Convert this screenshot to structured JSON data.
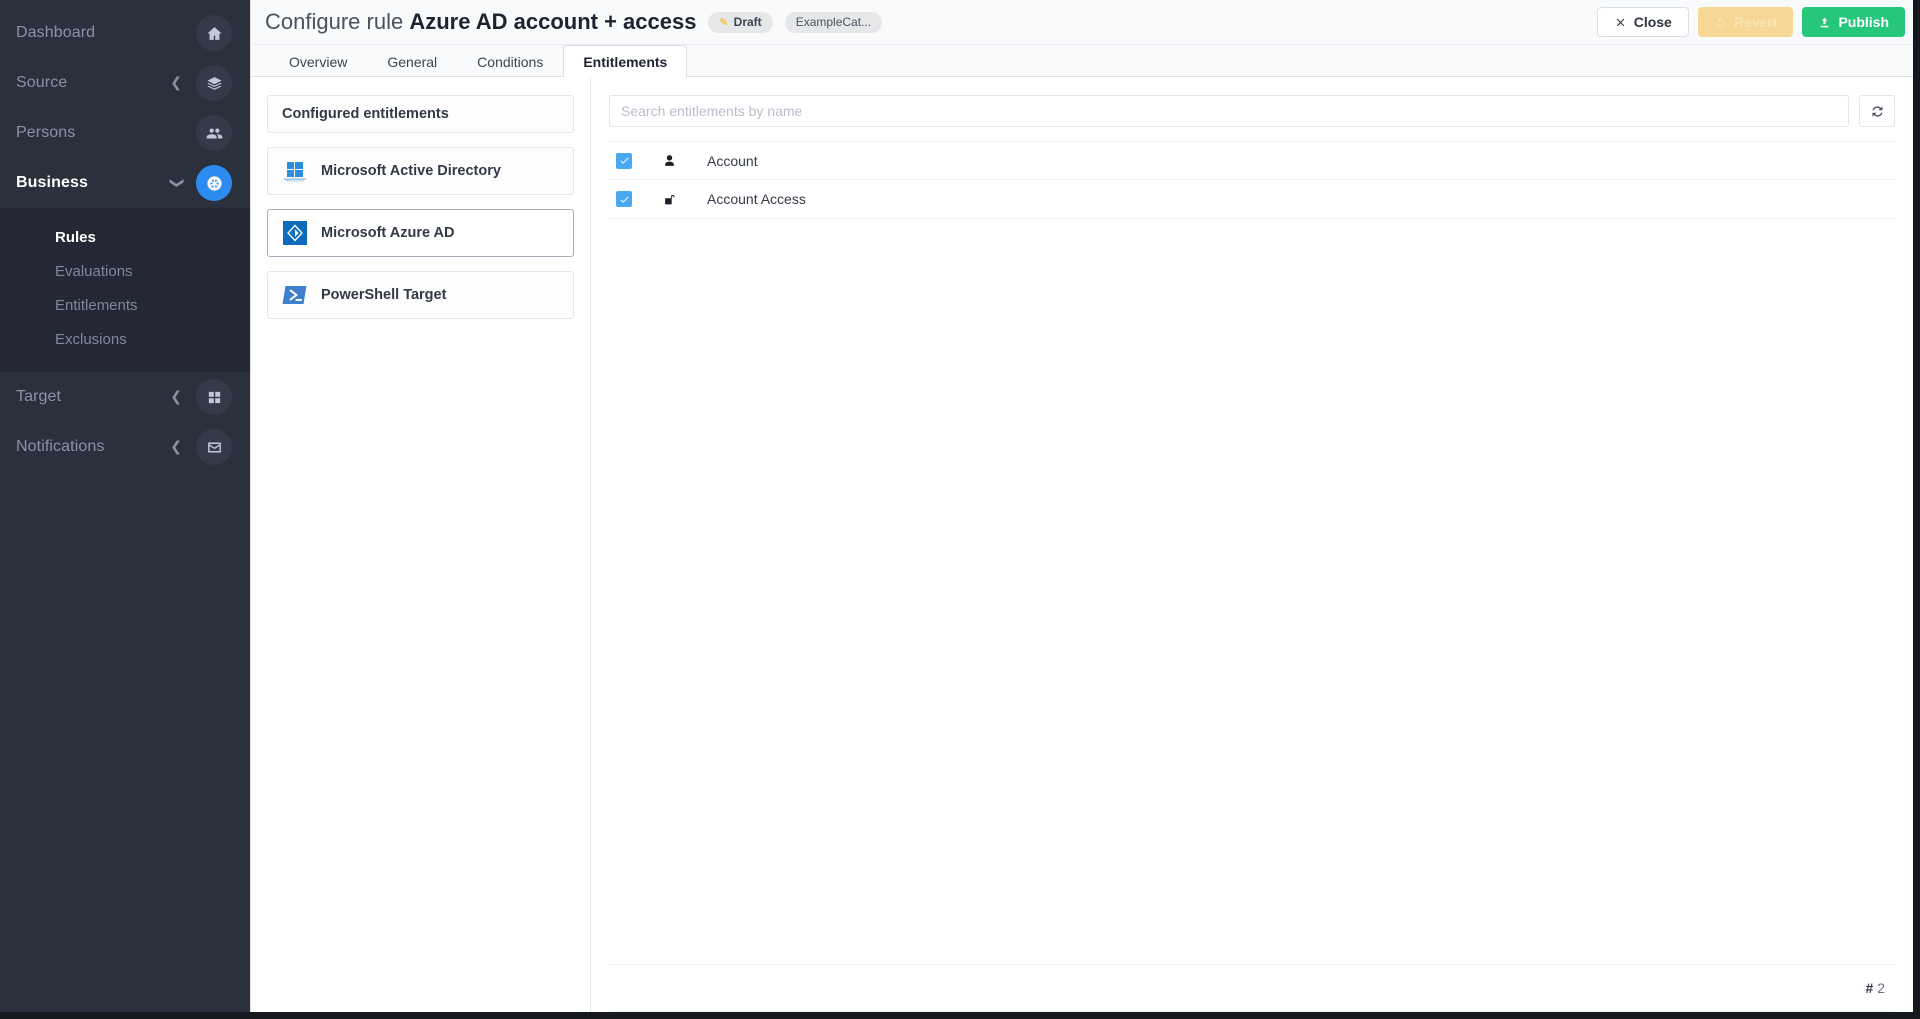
{
  "sidebar": {
    "items": [
      {
        "label": "Dashboard",
        "icon": "home-icon",
        "chevron": "",
        "active": false
      },
      {
        "label": "Source",
        "icon": "layers-icon",
        "chevron": "left",
        "active": false
      },
      {
        "label": "Persons",
        "icon": "people-icon",
        "chevron": "",
        "active": false
      },
      {
        "label": "Business",
        "icon": "business-icon",
        "chevron": "down",
        "active": true
      }
    ],
    "submenu": [
      {
        "label": "Rules",
        "active": true
      },
      {
        "label": "Evaluations",
        "active": false
      },
      {
        "label": "Entitlements",
        "active": false
      },
      {
        "label": "Exclusions",
        "active": false
      }
    ],
    "items_bottom": [
      {
        "label": "Target",
        "icon": "grid-icon",
        "chevron": "left",
        "active": false
      },
      {
        "label": "Notifications",
        "icon": "envelope-icon",
        "chevron": "left",
        "active": false
      }
    ]
  },
  "header": {
    "title_prefix": "Configure rule",
    "title_name": "Azure AD account + access",
    "status_badge": "Draft",
    "category_badge": "ExampleCat...",
    "buttons": {
      "close": "Close",
      "revert": "Revert",
      "publish": "Publish"
    }
  },
  "tabs": [
    {
      "label": "Overview",
      "active": false
    },
    {
      "label": "General",
      "active": false
    },
    {
      "label": "Conditions",
      "active": false
    },
    {
      "label": "Entitlements",
      "active": true
    }
  ],
  "left_panel": {
    "header": "Configured entitlements",
    "systems": [
      {
        "label": "Microsoft Active Directory",
        "icon": "windows-ad-icon",
        "selected": false
      },
      {
        "label": "Microsoft Azure AD",
        "icon": "azure-ad-icon",
        "selected": true
      },
      {
        "label": "PowerShell Target",
        "icon": "powershell-icon",
        "selected": false
      }
    ]
  },
  "right_panel": {
    "search_placeholder": "Search entitlements by name",
    "search_value": "",
    "refresh_icon": "refresh-icon",
    "entitlements": [
      {
        "name": "Account",
        "icon": "person-icon",
        "checked": true
      },
      {
        "name": "Account Access",
        "icon": "unlock-icon",
        "checked": true
      }
    ],
    "count_symbol": "#",
    "count_value": "2"
  },
  "colors": {
    "accent_blue": "#2d8cf0",
    "checkbox_blue": "#4aa8f0",
    "publish_green": "#27c77b",
    "revert_yellow": "#f7d794",
    "sidebar_bg": "#2a303c",
    "submenu_bg": "#232834"
  }
}
